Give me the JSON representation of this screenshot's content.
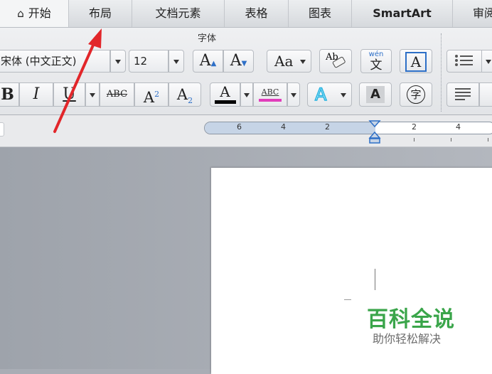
{
  "tabs": [
    "开始",
    "布局",
    "文档元素",
    "表格",
    "图表",
    "SmartArt",
    "审阅"
  ],
  "ribbon": {
    "group_label": "字体",
    "font_name": "宋体 (中文正文)",
    "font_size": "12",
    "grow_label": "A",
    "shrink_label": "A",
    "case_label": "Aa",
    "phonetic_top": "wén",
    "phonetic_char": "文",
    "charborder_label": "A",
    "bold": "B",
    "italic": "I",
    "underline": "U",
    "strike": "ABC",
    "superscript": "A",
    "superscript_mark": "2",
    "subscript": "A",
    "subscript_mark": "2",
    "font_color": "A",
    "highlight": "ABC",
    "text_effect": "A",
    "char_shading": "A",
    "enclose_char": "字"
  },
  "ruler": {
    "ticks": [
      "6",
      "4",
      "2",
      "2",
      "4"
    ]
  },
  "watermark": {
    "title": "百科全说",
    "subtitle": "助你轻松解决"
  },
  "colors": {
    "arrow": "#e2262a",
    "watermark": "#3aa54a",
    "highlight": "#e13dbb"
  }
}
